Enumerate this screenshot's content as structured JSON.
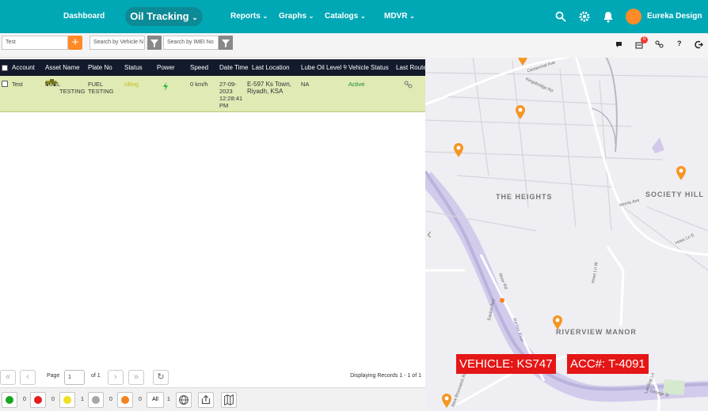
{
  "nav": {
    "dashboard": "Dashboard",
    "active": "Oil Tracking",
    "reports": "Reports",
    "graphs": "Graphs",
    "catalogs": "Catalogs",
    "mdvr": "MDVR",
    "user": "Eureka Design"
  },
  "filters": {
    "value": "Test",
    "vehicle_placeholder": "Search by Vehicle N",
    "imei_placeholder": "Search by IMEI No"
  },
  "table": {
    "headers": [
      "Account",
      "Asset Name",
      "Plate No",
      "Status",
      "Power",
      "Speed",
      "Date Time",
      "Last Location",
      "Lube Oil Level %",
      "Vehicle Status",
      "Last Route"
    ],
    "row": {
      "account": "Test",
      "asset": "FUEL TESTING",
      "plate": "FUEL TESTING",
      "status": "Idling",
      "speed": "0 km/h",
      "datetime": "27-09-2023 12:28:41 PM",
      "location": "E-597 Ks Town, Riyadh, KSA",
      "lube": "NA",
      "vehicle_status": "Active"
    }
  },
  "pager": {
    "page_label": "Page",
    "page_value": "1",
    "of": "of 1",
    "records": "Displaying Records 1 - 1 of 1"
  },
  "status_counts": {
    "green": "0",
    "red": "0",
    "yellow": "1",
    "gray": "0",
    "orange": "0",
    "all_label": "All",
    "all": "1"
  },
  "map": {
    "notifications": "0",
    "areas": [
      "THE HEIGHTS",
      "SOCIETY HILL",
      "RIVERVIEW MANOR"
    ],
    "streets": [
      "Centennial Ave",
      "Kingsbridge Rd",
      "Hoes Ln W",
      "Morris Ave",
      "Hoes Ln E",
      "River Rd",
      "Easton Ave",
      "Raritan River",
      "New Brunswick Rd",
      "Landing Ln",
      "George St"
    ],
    "vehicle": "VEHICLE: KS747",
    "account": "ACC#: T-4091"
  },
  "colors": {
    "topbar": "#00a8b6",
    "accent": "#ff8a28",
    "header": "#121a2c",
    "row": "#dfeab5"
  }
}
